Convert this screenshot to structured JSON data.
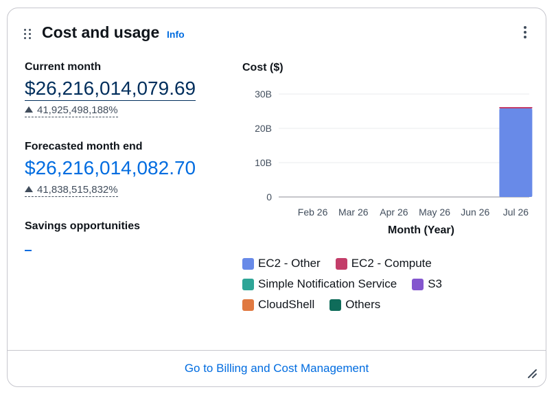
{
  "widget": {
    "title": "Cost and usage",
    "info_label": "Info",
    "footer_link": "Go to Billing and Cost Management"
  },
  "current_month": {
    "label": "Current month",
    "value": "$26,216,014,079.69",
    "delta": "41,925,498,188%"
  },
  "forecast": {
    "label": "Forecasted month end",
    "value": "$26,216,014,082.70",
    "delta": "41,838,515,832%"
  },
  "savings": {
    "label": "Savings opportunities",
    "value": "-"
  },
  "icons": [
    "drag-handle-icon",
    "more-options-icon",
    "triangle-up-icon",
    "resize-icon"
  ],
  "colors": {
    "ec2_other": "#688ae8",
    "ec2_compute": "#c33d69",
    "sns": "#2ea597",
    "s3": "#8456ce",
    "cloudshell": "#e07941",
    "others": "#0f6c5a",
    "link": "#006ce0"
  },
  "chart_data": {
    "type": "bar",
    "title": "Cost ($)",
    "xlabel": "Month (Year)",
    "ylabel": "Cost ($)",
    "categories": [
      "Feb 26",
      "Mar 26",
      "Apr 26",
      "May 26",
      "Jun 26",
      "Jul 26"
    ],
    "y_ticks": [
      "0",
      "10B",
      "20B",
      "30B"
    ],
    "ylim": [
      0,
      30000000000
    ],
    "stacked": true,
    "grid": true,
    "legend_position": "bottom",
    "series": [
      {
        "name": "EC2 - Other",
        "color": "#688ae8",
        "values": [
          0,
          0,
          0,
          0,
          0,
          25800000000
        ]
      },
      {
        "name": "EC2 - Compute",
        "color": "#c33d69",
        "values": [
          0,
          0,
          0,
          0,
          0,
          400000000
        ]
      },
      {
        "name": "Simple Notification Service",
        "color": "#2ea597",
        "values": [
          0,
          0,
          0,
          0,
          0,
          0
        ]
      },
      {
        "name": "S3",
        "color": "#8456ce",
        "values": [
          0,
          0,
          0,
          0,
          0,
          0
        ]
      },
      {
        "name": "CloudShell",
        "color": "#e07941",
        "values": [
          0,
          0,
          0,
          0,
          0,
          0
        ]
      },
      {
        "name": "Others",
        "color": "#0f6c5a",
        "values": [
          0,
          0,
          0,
          0,
          0,
          0
        ]
      }
    ]
  }
}
